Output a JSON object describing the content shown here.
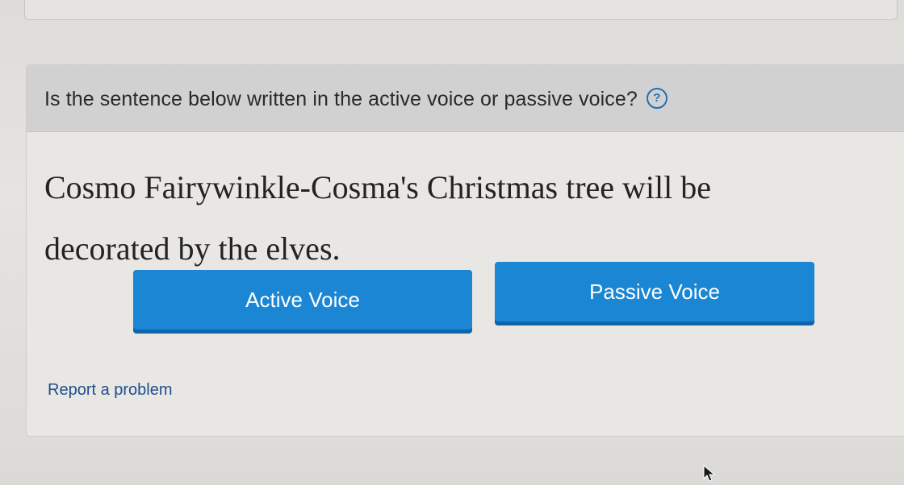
{
  "question": {
    "prompt": "Is the sentence below written in the active voice or passive voice?",
    "help_icon": "question-circle-icon",
    "help_glyph": "?"
  },
  "sentence": {
    "line1": "Cosmo Fairywinkle-Cosma's Christmas tree will be",
    "line2": "decorated by the elves."
  },
  "answers": {
    "active_label": "Active Voice",
    "passive_label": "Passive Voice"
  },
  "footer": {
    "report_label": "Report a problem"
  },
  "colors": {
    "button_blue": "#1a86d4",
    "button_shadow": "#0f64a8",
    "link_blue": "#1c4f8c",
    "help_blue": "#1e6fb8"
  },
  "cursor": {
    "icon": "mouse-pointer-icon"
  }
}
